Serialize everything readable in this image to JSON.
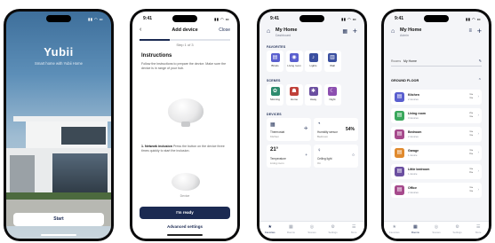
{
  "phones": [
    {
      "status": {
        "time": "",
        "signal": "▮▮ ◠ ▭"
      },
      "brand": "Yubii",
      "tagline": "Smart home with Yubii Home",
      "start_button": "Start"
    },
    {
      "status": {
        "time": "9:41",
        "signal": "▮▮ ◠ ▭"
      },
      "title": "Add device",
      "close": "Close",
      "progress_percent": 33,
      "step": "Step 1 of 3",
      "section": "Instructions",
      "description": "Follow the instructions to prepare the device. Make sure the device is in range of your hub.",
      "step2_title": "1. Network inclusion",
      "step2_text": "Press the button on the device three times quickly to start the inclusion.",
      "device_label": "Device",
      "ready_button": "I'm ready",
      "advanced": "Advanced settings"
    },
    {
      "status": {
        "time": "9:41",
        "signal": "▮▮ ◠ ▭"
      },
      "home_name": "My Home",
      "home_sub": "Dashboard",
      "favorites_label": "FAVORITES",
      "favorites": [
        {
          "icon": "▤",
          "label": "Blinds",
          "color": "#5a5fcf"
        },
        {
          "icon": "◉",
          "label": "Living room",
          "color": "#5a5fcf"
        },
        {
          "icon": "♪",
          "label": "Lights",
          "color": "#3b4fa0"
        },
        {
          "icon": "▥",
          "label": "Wall",
          "color": "#3b4fa0"
        }
      ],
      "scenes_label": "SCENES",
      "scenes": [
        {
          "icon": "✿",
          "label": "Morning",
          "color": "#2e8b6e"
        },
        {
          "icon": "☗",
          "label": "Home",
          "color": "#c0413a"
        },
        {
          "icon": "✱",
          "label": "Away",
          "color": "#6b4fa0"
        },
        {
          "icon": "☾",
          "label": "Night",
          "color": "#8c4fb0"
        }
      ],
      "devices_label": "DEVICES",
      "devices": [
        {
          "icon": "▦",
          "name": "Thermostat",
          "state": "Kitchen",
          "value": "",
          "control": "✣"
        },
        {
          "icon": "◔",
          "name": "Humidity sensor",
          "state": "Bedroom",
          "value": "54%",
          "control": ""
        },
        {
          "icon": "",
          "big": "21°",
          "name": "Temperature",
          "state": "Living room",
          "value": "",
          "control": "+"
        },
        {
          "icon": "♀",
          "name": "Ceiling light",
          "state": "On",
          "value": "",
          "control": "○"
        }
      ],
      "tabs": [
        {
          "icon": "★",
          "label": "Favorites",
          "active": true
        },
        {
          "icon": "▦",
          "label": "Rooms",
          "active": false
        },
        {
          "icon": "◎",
          "label": "Scenes",
          "active": false
        },
        {
          "icon": "⚙",
          "label": "Settings",
          "active": false
        },
        {
          "icon": "☰",
          "label": "More",
          "active": false
        }
      ]
    },
    {
      "status": {
        "time": "9:41",
        "signal": "▮▮ ◠ ▭"
      },
      "home_name": "My Home",
      "home_sub": "Admin",
      "field_label": "Rooms",
      "field_value": "My Home",
      "floor_name": "GROUND FLOOR",
      "rooms": [
        {
          "icon": "▤",
          "name": "Kitchen",
          "sub": "2 devices",
          "counts": "1 ▸\n1 ▸",
          "color": "#5a5fcf"
        },
        {
          "icon": "▤",
          "name": "Living room",
          "sub": "3 devices",
          "counts": "2 ▸\n1 ▸",
          "color": "#3aa85c"
        },
        {
          "icon": "▤",
          "name": "Bedroom",
          "sub": "2 devices",
          "counts": "1 ▸\n1 ▸",
          "color": "#a64a8c"
        },
        {
          "icon": "▤",
          "name": "Garage",
          "sub": "1 device",
          "counts": "1 ▸\n0 ▸",
          "color": "#e08a2e"
        },
        {
          "icon": "▤",
          "name": "Little bedroom",
          "sub": "1 device",
          "counts": "1 ▸\n0 ▸",
          "color": "#6b4fa0"
        },
        {
          "icon": "▤",
          "name": "Office",
          "sub": "2 devices",
          "counts": "1 ▸\n1 ▸",
          "color": "#a64a8c"
        }
      ],
      "tabs": [
        {
          "icon": "★",
          "label": "Favorites",
          "active": false
        },
        {
          "icon": "▦",
          "label": "Rooms",
          "active": true
        },
        {
          "icon": "◎",
          "label": "Scenes",
          "active": false
        },
        {
          "icon": "⚙",
          "label": "Settings",
          "active": false
        },
        {
          "icon": "☰",
          "label": "More",
          "active": false
        }
      ]
    }
  ]
}
